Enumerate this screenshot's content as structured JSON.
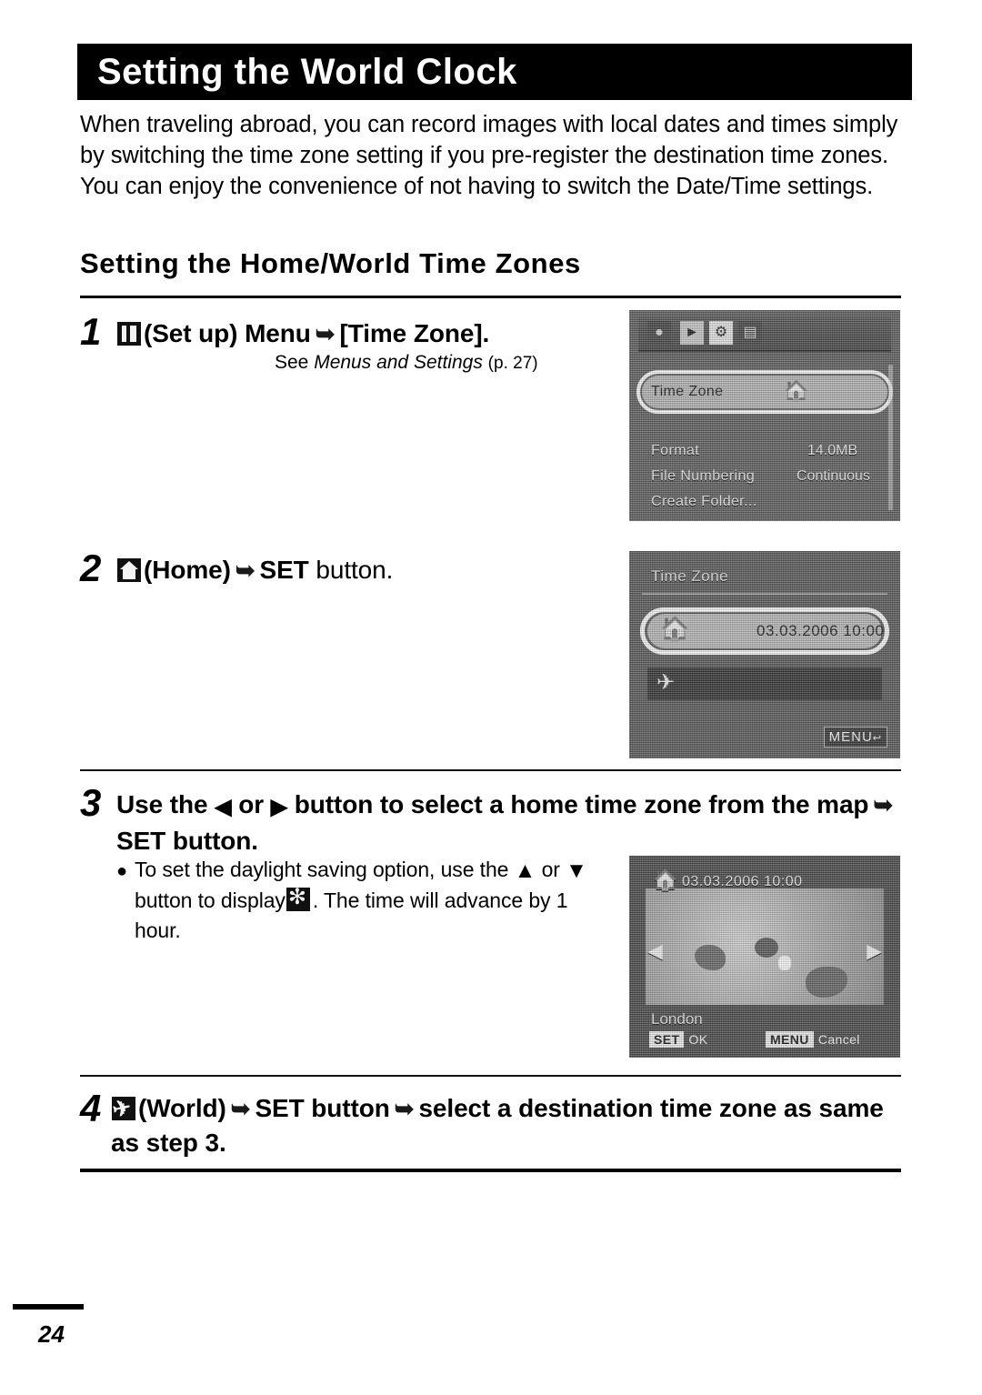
{
  "page": {
    "title": "Setting the World Clock",
    "number": "24"
  },
  "intro": "When traveling abroad, you can record images with local dates and times simply by switching the time zone setting if you pre-register the destination time zones. You can enjoy the convenience of not having to switch the Date/Time settings.",
  "section_heading": "Setting the Home/World Time Zones",
  "steps": [
    {
      "number": "1",
      "icon": "setup-icon",
      "text_before": "(Set up) Menu",
      "text_after": "[Time Zone].",
      "note_prefix": "See ",
      "note_italic": "Menus and Settings",
      "note_page": "(p. 27)"
    },
    {
      "number": "2",
      "icon": "home-icon",
      "text_before": "(Home)",
      "text_bold": "SET",
      "text_after": "button."
    },
    {
      "number": "3",
      "line1_a": "Use the",
      "line1_b": "or",
      "line1_c": "button to select a home time zone from",
      "line2_a": "the map",
      "line2_bold": "SET",
      "line2_b": "button.",
      "bullet_line1": "To set the daylight saving option, use the",
      "bullet_line2_a": "or",
      "bullet_line2_b": "button to display",
      "bullet_line2_c": ". The time",
      "bullet_line3": "will advance by 1 hour."
    },
    {
      "number": "4",
      "icon": "world-icon",
      "line1_a": "(World)",
      "line1_bold1": "SET",
      "line1_b": "button",
      "line1_c": "select a destination time",
      "line2": "zone as same as step 3."
    }
  ],
  "lcd_menu": {
    "tabs": [
      "camera-tab",
      "play-tab",
      "setup-tab",
      "print-tab"
    ],
    "highlighted_row_label": "Time Zone",
    "highlighted_row_value": "home-icon",
    "rows": [
      {
        "label": "Format",
        "value": "14.0MB"
      },
      {
        "label": "File Numbering",
        "value": "Continuous"
      },
      {
        "label": "Create Folder...",
        "value": ""
      }
    ]
  },
  "lcd_timezone": {
    "title": "Time Zone",
    "home_icon": "home-icon",
    "home_datetime": "03.03.2006 10:00",
    "world_icon": "world-icon",
    "menu_button": "MENU",
    "menu_button_sub": "↩"
  },
  "lcd_map": {
    "header_icon": "home-icon",
    "header_datetime": "03.03.2006 10:00",
    "city": "London",
    "left_arrow": "◀",
    "right_arrow": "▶",
    "set_key": "SET",
    "set_label": "OK",
    "menu_key": "MENU",
    "menu_label": "Cancel"
  },
  "glyphs": {
    "arrow_right": "➥",
    "tri_left": "◀",
    "tri_right": "▶",
    "tri_up": "▲",
    "tri_down": "▼",
    "bullet": "●"
  },
  "colors": {
    "ink": "#000000",
    "paper": "#ffffff",
    "banner": "#000000"
  }
}
